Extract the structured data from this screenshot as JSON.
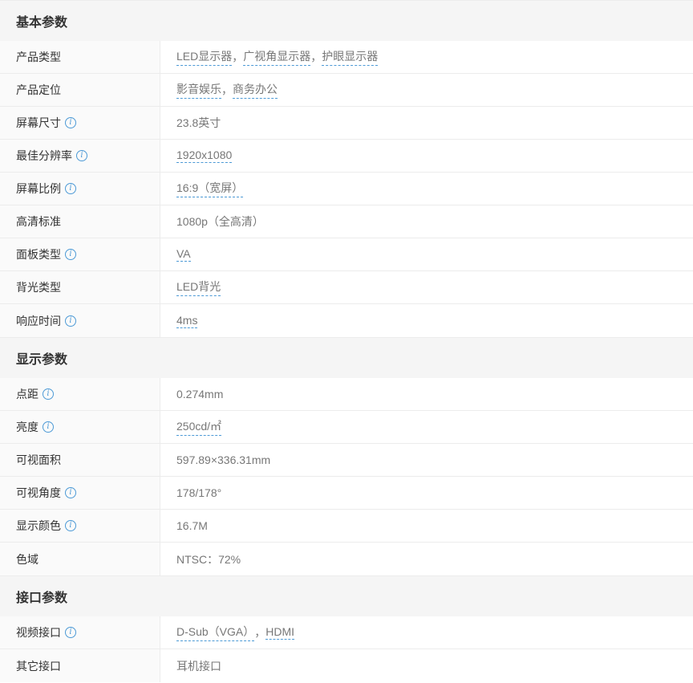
{
  "sections": [
    {
      "title": "基本参数",
      "rows": [
        {
          "label": "产品类型",
          "info": false,
          "parts": [
            {
              "t": "LED显示器",
              "link": true
            },
            {
              "t": "，",
              "link": false
            },
            {
              "t": "广视角显示器",
              "link": true
            },
            {
              "t": "，",
              "link": false
            },
            {
              "t": "护眼显示器",
              "link": true
            }
          ]
        },
        {
          "label": "产品定位",
          "info": false,
          "parts": [
            {
              "t": "影音娱乐",
              "link": true
            },
            {
              "t": "，",
              "link": false
            },
            {
              "t": "商务办公",
              "link": true
            }
          ]
        },
        {
          "label": "屏幕尺寸",
          "info": true,
          "parts": [
            {
              "t": "23.8英寸",
              "link": false
            }
          ]
        },
        {
          "label": "最佳分辨率",
          "info": true,
          "parts": [
            {
              "t": "1920x1080",
              "link": true
            }
          ]
        },
        {
          "label": "屏幕比例",
          "info": true,
          "parts": [
            {
              "t": "16:9（宽屏）",
              "link": true
            }
          ]
        },
        {
          "label": "高清标准",
          "info": false,
          "parts": [
            {
              "t": "1080p（全高清）",
              "link": false
            }
          ]
        },
        {
          "label": "面板类型",
          "info": true,
          "parts": [
            {
              "t": "VA",
              "link": true
            }
          ]
        },
        {
          "label": "背光类型",
          "info": false,
          "parts": [
            {
              "t": "LED背光",
              "link": true
            }
          ]
        },
        {
          "label": "响应时间",
          "info": true,
          "parts": [
            {
              "t": "4ms",
              "link": true
            }
          ]
        }
      ]
    },
    {
      "title": "显示参数",
      "rows": [
        {
          "label": "点距",
          "info": true,
          "parts": [
            {
              "t": "0.274mm",
              "link": false
            }
          ]
        },
        {
          "label": "亮度",
          "info": true,
          "parts": [
            {
              "t": "250cd/㎡",
              "link": true
            }
          ]
        },
        {
          "label": "可视面积",
          "info": false,
          "parts": [
            {
              "t": "597.89×336.31mm",
              "link": false
            }
          ]
        },
        {
          "label": "可视角度",
          "info": true,
          "parts": [
            {
              "t": "178/178°",
              "link": false
            }
          ]
        },
        {
          "label": "显示颜色",
          "info": true,
          "parts": [
            {
              "t": "16.7M",
              "link": false
            }
          ]
        },
        {
          "label": "色域",
          "info": false,
          "parts": [
            {
              "t": "NTSC：72%",
              "link": false
            }
          ]
        }
      ]
    },
    {
      "title": "接口参数",
      "rows": [
        {
          "label": "视频接口",
          "info": true,
          "parts": [
            {
              "t": "D-Sub（VGA）",
              "link": true
            },
            {
              "t": "，",
              "link": false
            },
            {
              "t": "HDMI",
              "link": true
            }
          ]
        },
        {
          "label": "其它接口",
          "info": false,
          "parts": [
            {
              "t": "耳机接口",
              "link": false
            }
          ]
        }
      ]
    }
  ],
  "info_glyph": "i",
  "colors": {
    "accent": "#4d9ad6",
    "label_bg": "#fafafa",
    "head_bg": "#f5f5f5",
    "border": "#ececec"
  }
}
